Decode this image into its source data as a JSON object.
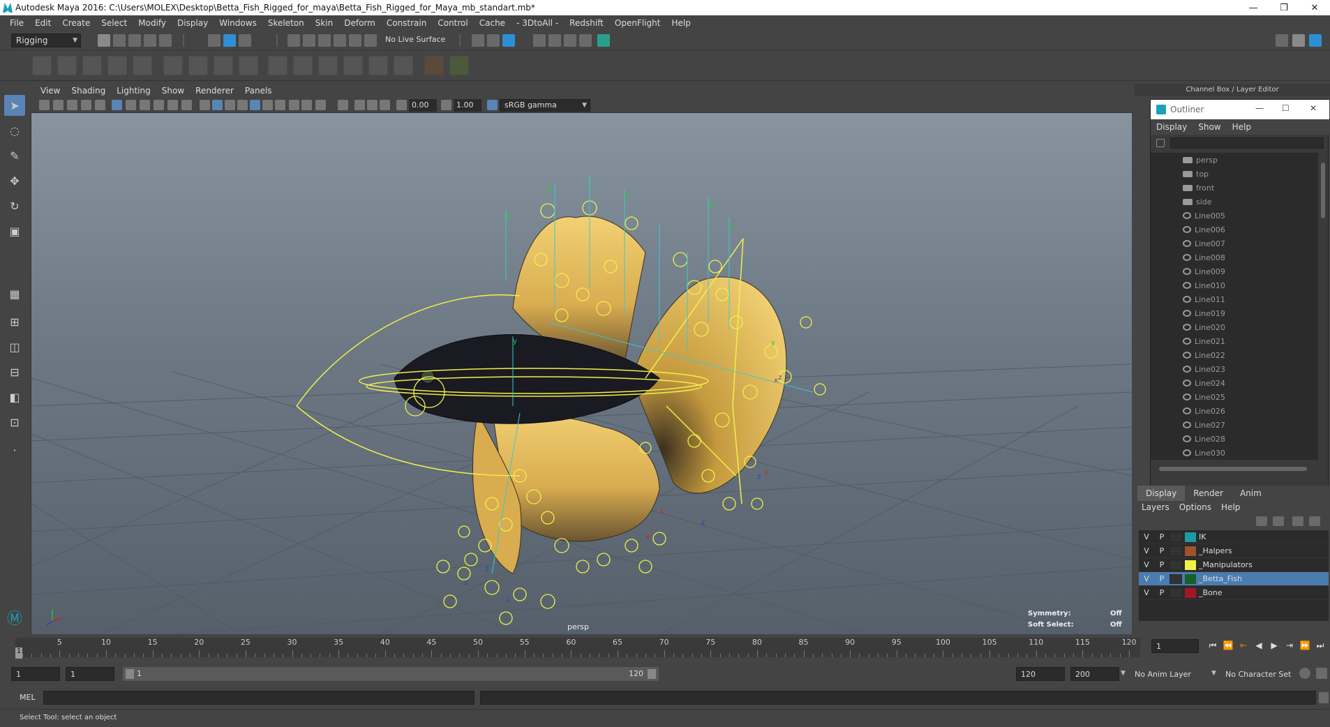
{
  "window": {
    "title": "Autodesk Maya 2016: C:\\Users\\MOLEX\\Desktop\\Betta_Fish_Rigged_for_maya\\Betta_Fish_Rigged_for_Maya_mb_standart.mb*",
    "minimize_glyph": "—",
    "restore_glyph": "❐",
    "close_glyph": "✕"
  },
  "menubar": {
    "items": [
      "File",
      "Edit",
      "Create",
      "Select",
      "Modify",
      "Display",
      "Windows",
      "Skeleton",
      "Skin",
      "Deform",
      "Constrain",
      "Control",
      "Cache",
      "- 3DtoAll -",
      "Redshift",
      "OpenFlight",
      "Help"
    ]
  },
  "statusline": {
    "menuset": "Rigging",
    "live_surface": "No Live Surface"
  },
  "viewport": {
    "menus": [
      "View",
      "Shading",
      "Lighting",
      "Show",
      "Renderer",
      "Panels"
    ],
    "exposure": "0.00",
    "gamma": "1.00",
    "color_space": "sRGB gamma",
    "camera_label": "persp",
    "hud": {
      "symmetry_label": "Symmetry:",
      "symmetry_value": "Off",
      "soft_select_label": "Soft Select:",
      "soft_select_value": "Off"
    }
  },
  "channel_box": {
    "header": "Channel Box / Layer Editor"
  },
  "outliner": {
    "title": "Outliner",
    "menus": [
      "Display",
      "Show",
      "Help"
    ],
    "items": [
      {
        "label": "persp",
        "icon": "camera-icon"
      },
      {
        "label": "top",
        "icon": "camera-icon"
      },
      {
        "label": "front",
        "icon": "camera-icon"
      },
      {
        "label": "side",
        "icon": "camera-icon"
      },
      {
        "label": "Line005",
        "icon": "curve-icon"
      },
      {
        "label": "Line006",
        "icon": "curve-icon"
      },
      {
        "label": "Line007",
        "icon": "curve-icon"
      },
      {
        "label": "Line008",
        "icon": "curve-icon"
      },
      {
        "label": "Line009",
        "icon": "curve-icon"
      },
      {
        "label": "Line010",
        "icon": "curve-icon"
      },
      {
        "label": "Line011",
        "icon": "curve-icon"
      },
      {
        "label": "Line019",
        "icon": "curve-icon"
      },
      {
        "label": "Line020",
        "icon": "curve-icon"
      },
      {
        "label": "Line021",
        "icon": "curve-icon"
      },
      {
        "label": "Line022",
        "icon": "curve-icon"
      },
      {
        "label": "Line023",
        "icon": "curve-icon"
      },
      {
        "label": "Line024",
        "icon": "curve-icon"
      },
      {
        "label": "Line025",
        "icon": "curve-icon"
      },
      {
        "label": "Line026",
        "icon": "curve-icon"
      },
      {
        "label": "Line027",
        "icon": "curve-icon"
      },
      {
        "label": "Line028",
        "icon": "curve-icon"
      },
      {
        "label": "Line030",
        "icon": "curve-icon"
      }
    ]
  },
  "layer_editor": {
    "tabs": [
      "Display",
      "Render",
      "Anim"
    ],
    "active_tab": "Display",
    "menus": [
      "Layers",
      "Options",
      "Help"
    ],
    "layers": [
      {
        "v": "V",
        "p": "P",
        "name": "IK",
        "color": "#1c9aa8",
        "selected": false
      },
      {
        "v": "V",
        "p": "P",
        "name": "_Halpers",
        "color": "#a0522d",
        "selected": false
      },
      {
        "v": "V",
        "p": "P",
        "name": "_Manipulators",
        "color": "#f2f246",
        "selected": false
      },
      {
        "v": "V",
        "p": "P",
        "name": "_Betta_Fish",
        "color": "#1a5e2a",
        "selected": true
      },
      {
        "v": "V",
        "p": "P",
        "name": "_Bone",
        "color": "#a01828",
        "selected": false
      }
    ]
  },
  "timeline": {
    "ticks": [
      "5",
      "10",
      "15",
      "20",
      "25",
      "30",
      "35",
      "40",
      "45",
      "50",
      "55",
      "60",
      "65",
      "70",
      "75",
      "80",
      "85",
      "90",
      "95",
      "100",
      "105",
      "110",
      "115",
      "120"
    ],
    "current_frame": "1",
    "frame_field": "1"
  },
  "range": {
    "start": "1",
    "playback_start": "1",
    "bar_start": "1",
    "bar_end": "120",
    "playback_end": "120",
    "end": "200",
    "anim_layer": "No Anim Layer",
    "character_set": "No Character Set"
  },
  "command_line": {
    "label": "MEL"
  },
  "help_line": {
    "text": "Select Tool: select an object"
  },
  "colors": {
    "accent": "#5a84b5",
    "fin_yellow": "#e8c25a",
    "fish_body": "#1a1a22",
    "curve_yellow": "#f0f048"
  }
}
